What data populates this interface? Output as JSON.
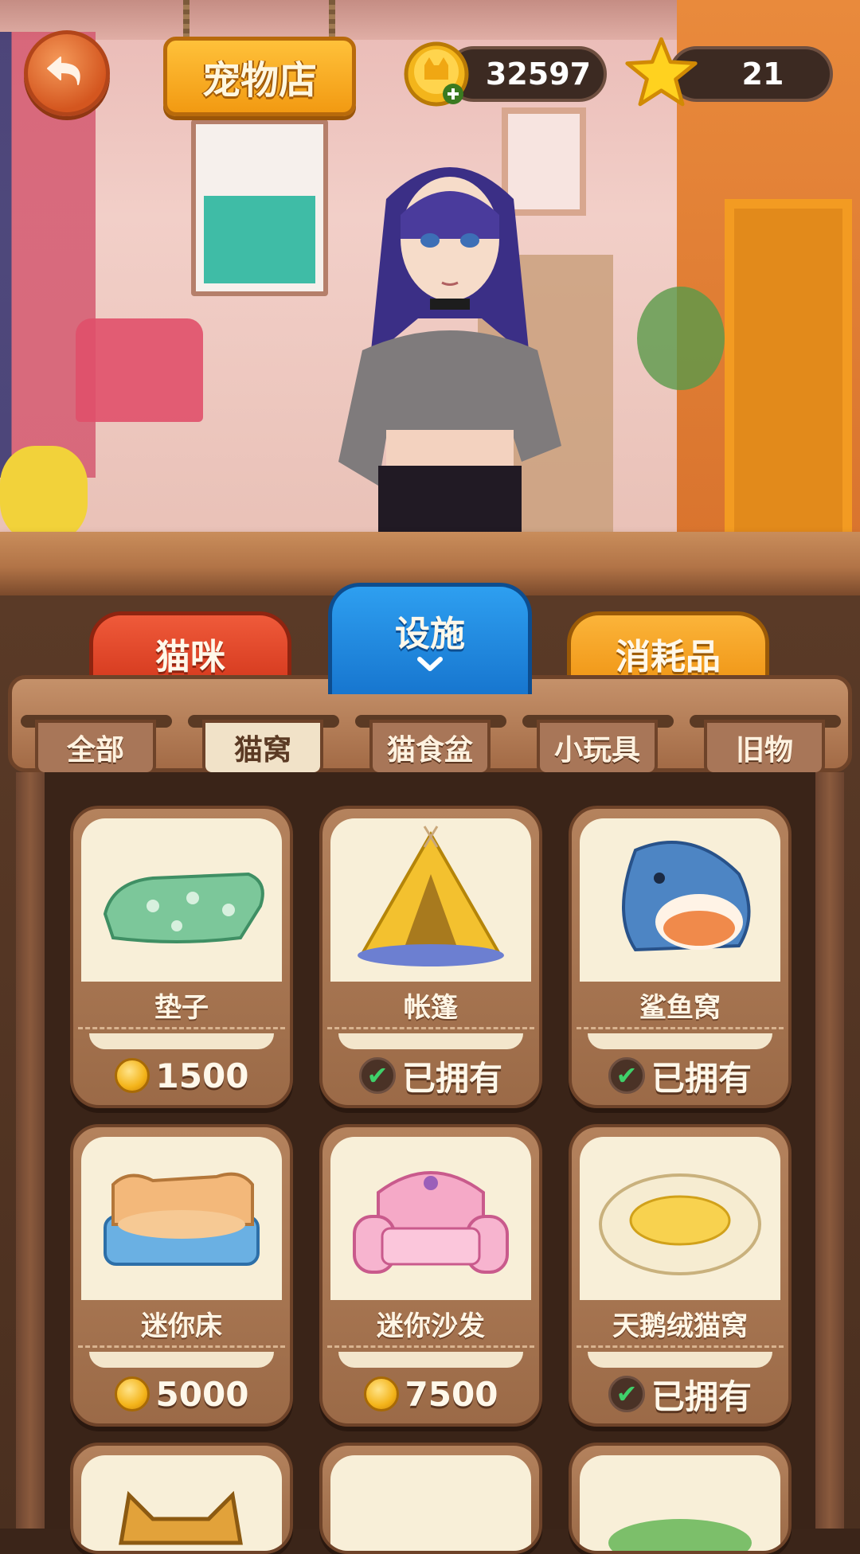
{
  "header": {
    "title": "宠物店",
    "coins": "32597",
    "stars": "21"
  },
  "category_tabs": [
    {
      "label": "猫咪"
    },
    {
      "label": "设施"
    },
    {
      "label": "消耗品"
    }
  ],
  "sub_tabs": [
    {
      "label": "全部"
    },
    {
      "label": "猫窝"
    },
    {
      "label": "猫食盆"
    },
    {
      "label": "小玩具"
    },
    {
      "label": "旧物"
    }
  ],
  "items": [
    {
      "name": "垫子",
      "status": "1500"
    },
    {
      "name": "帐篷",
      "status": "已拥有"
    },
    {
      "name": "鲨鱼窝",
      "status": "已拥有"
    },
    {
      "name": "迷你床",
      "status": "5000"
    },
    {
      "name": "迷你沙发",
      "status": "7500"
    },
    {
      "name": "天鹅绒猫窝",
      "status": "已拥有"
    }
  ]
}
